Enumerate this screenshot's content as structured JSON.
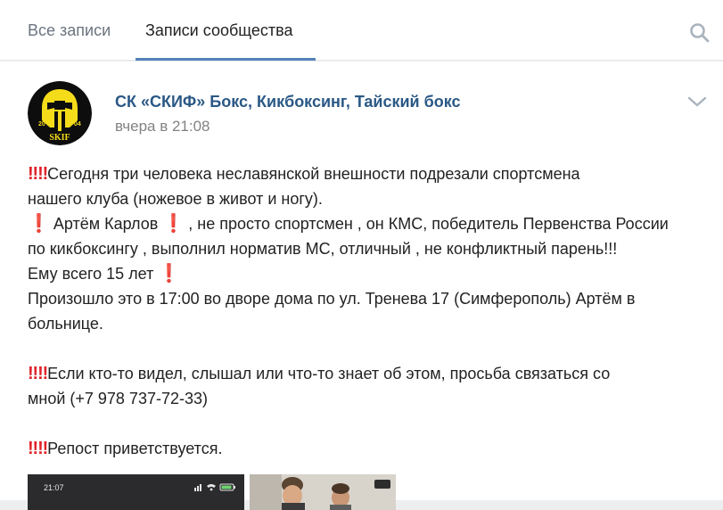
{
  "tabs": [
    {
      "label": "Все записи",
      "active": false
    },
    {
      "label": "Записи сообщества",
      "active": true
    }
  ],
  "post": {
    "author": "СК «СКИФ» Бокс, Кикбоксинг, Тайский бокс",
    "time": "вчера в 21:08",
    "avatar_text": {
      "top": "SKIF",
      "left": "20",
      "right": "04"
    },
    "lines": [
      {
        "emoji_before": "‼‼",
        "text": "Сегодня три человека неславянской внешности подрезали спортсмена"
      },
      {
        "text": "нашего клуба (ножевое в живот и ногу)."
      },
      {
        "emoji_before": "❗",
        "text": " Артём Карлов ",
        "emoji_after": "❗",
        "text_after": " , не просто спортсмен , он КМС, победитель Первенства России"
      },
      {
        "text": "по кикбоксингу , выполнил норматив МС, отличный , не конфликтный парень!!!"
      },
      {
        "text": "Ему всего 15 лет ",
        "emoji_after": "❗"
      },
      {
        "text": "Произошло это в 17:00 во дворе дома по ул. Тренева 17 (Симферополь) Артём в"
      },
      {
        "text": "больнице."
      },
      {
        "emoji_before": "‼‼",
        "text": "Если кто-то видел, слышал или что-то знает об этом, просьба связаться со"
      },
      {
        "text": "мной (+7 978 737-72-33)"
      },
      {
        "emoji_before": "‼‼",
        "text": "Репост приветствуется."
      }
    ],
    "photo1_status_time": "21:07"
  },
  "colors": {
    "link": "#2a5885",
    "accent": "#5181b8",
    "emoji_red": "#e0242a",
    "muted": "#828282"
  },
  "icons": [
    "search-icon",
    "chevron-down-icon",
    "exclamation-icon"
  ]
}
